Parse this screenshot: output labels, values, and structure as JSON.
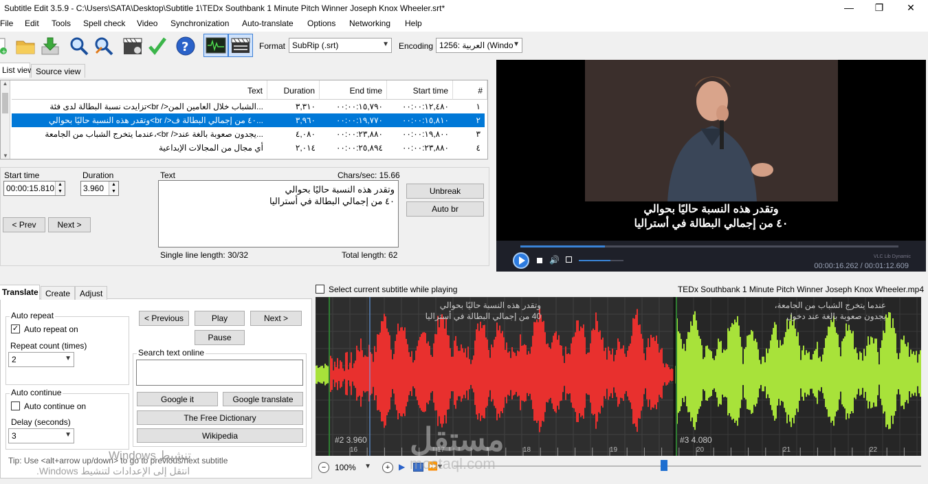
{
  "window": {
    "title": "Subtitle Edit 3.5.9 - C:\\Users\\SATA\\Desktop\\Subtitle 1\\TEDx Southbank 1 Minute Pitch Winner Joseph Knox Wheeler.srt*",
    "controls": [
      "—",
      "❐",
      "✕"
    ]
  },
  "menu": [
    "File",
    "Edit",
    "Tools",
    "Spell check",
    "Video",
    "Synchronization",
    "Auto-translate",
    "Options",
    "Networking",
    "Help"
  ],
  "toolbar": {
    "format_label": "Format",
    "format_value": "SubRip (.srt)",
    "encoding_label": "Encoding",
    "encoding_value": "1256: العربية (Windo",
    "icons": [
      "new-icon",
      "open-folder-icon",
      "download-icon",
      "find-icon",
      "replace-icon",
      "video-icon",
      "check-icon",
      "help-icon",
      "waveform-icon",
      "clapper-icon"
    ]
  },
  "view_tabs": [
    "List view",
    "Source view"
  ],
  "grid": {
    "headers": {
      "text": "Text",
      "duration": "Duration",
      "end": "End time",
      "start": "Start time",
      "num": "#"
    },
    "rows": [
      {
        "num": "١",
        "start": "٠٠:٠٠:١٢,٤٨٠",
        "end": "٠٠:٠٠:١٥,٧٩٠",
        "duration": "٣,٣١٠",
        "text": "تزايدت نسبة البطالة لدى فئة<br />الشباب خلال العامين المن..."
      },
      {
        "num": "٢",
        "start": "٠٠:٠٠:١٥,٨١٠",
        "end": "٠٠:٠٠:١٩,٧٧٠",
        "duration": "٣,٩٦٠",
        "text": "وتقدر هذه النسبة حاليًا بحوالي<br />٤٠ من إجمالي البطالة ف..."
      },
      {
        "num": "٣",
        "start": "٠٠:٠٠:١٩,٨٠٠",
        "end": "٠٠:٠٠:٢٣,٨٨٠",
        "duration": "٤,٠٨٠",
        "text": "عندما يتخرج الشباب من الجامعة،<br />يجدون صعوبة بالغة عند..."
      },
      {
        "num": "٤",
        "start": "٠٠:٠٠:٢٣,٨٨٠",
        "end": "٠٠:٠٠:٢٥,٨٩٤",
        "duration": "٢,٠١٤",
        "text": "أي مجال من المجالات الإبداعية"
      }
    ]
  },
  "editor": {
    "start_label": "Start time",
    "start_value": "00:00:15.810",
    "duration_label": "Duration",
    "duration_value": "3.960",
    "text_label": "Text",
    "chars_sec": "Chars/sec: 15.66",
    "line1": "وتقدر هذه النسبة حاليًا بحوالي",
    "line2": "٤٠ من إجمالي البطالة في أستراليا",
    "single_line": "Single line length: 30/32",
    "total_length": "Total length: 62",
    "unbreak": "Unbreak",
    "auto_br": "Auto br",
    "prev": "< Prev",
    "next": "Next >"
  },
  "video": {
    "subtitle_line1": "وتقدر هذه النسبة حاليًا بحوالي",
    "subtitle_line2": "٤٠ من إجمالي البطالة في أستراليا",
    "vlc_label": "VLC Lib Dynamic",
    "time": "00:00:16.262 / 00:01:12.609",
    "progress": 0.224,
    "volume": 0.7
  },
  "bottom_tabs": [
    "Translate",
    "Create",
    "Adjust"
  ],
  "translate": {
    "auto_repeat_title": "Auto repeat",
    "auto_repeat_on": "Auto repeat on",
    "auto_repeat_checked": true,
    "repeat_count_label": "Repeat count (times)",
    "repeat_count_value": "2",
    "auto_continue_title": "Auto continue",
    "auto_continue_on": "Auto continue on",
    "auto_continue_checked": false,
    "delay_label": "Delay (seconds)",
    "delay_value": "3",
    "previous": "< Previous",
    "play": "Play",
    "next": "Next >",
    "pause": "Pause",
    "search_online_title": "Search text online",
    "google_it": "Google it",
    "google_translate": "Google translate",
    "free_dictionary": "The Free Dictionary",
    "wikipedia": "Wikipedia",
    "tip": "Tip: Use <alt+arrow up/down> to go to previous/next subtitle"
  },
  "wave": {
    "select_current": "Select current subtitle while playing",
    "filename": "TEDx Southbank 1 Minute Pitch Winner Joseph Knox Wheeler.mp4",
    "p1_line1": "وتقدر هذه النسبة حاليًا بحوالي",
    "p1_line2": "40 من إجمالي البطالة في أستراليا",
    "p2_line1": "عندما يتخرج الشباب من الجامعة،",
    "p2_line2": "يجدون صعوبة بالغة عند دخول",
    "label1": "#2  3.960",
    "label2": "#3  4.080",
    "ticks": [
      "16",
      "17",
      "18",
      "19",
      "20",
      "21",
      "22"
    ],
    "zoom": "100%",
    "position_fraction": 0.45
  },
  "watermark": {
    "activate1": "تنشيط Windows",
    "activate2": "انتقل إلى الإعدادات لتنشيط Windows.",
    "brand": "مستقل",
    "brand_url": "mostaql.com"
  },
  "colors": {
    "selection": "#0078d7",
    "wave_active": "#e8302e",
    "wave_other": "#a8e23a",
    "wave_bg": "#262626"
  }
}
